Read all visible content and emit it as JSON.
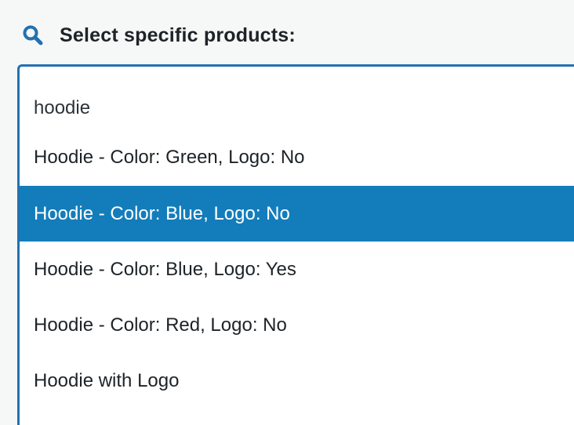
{
  "header": {
    "icon": "search-icon",
    "title": "Select specific products:"
  },
  "search": {
    "value": "hoodie"
  },
  "results": [
    {
      "label": "Hoodie - Color: Green, Logo: No",
      "highlighted": false
    },
    {
      "label": "Hoodie - Color: Blue, Logo: No",
      "highlighted": true
    },
    {
      "label": "Hoodie - Color: Blue, Logo: Yes",
      "highlighted": false
    },
    {
      "label": "Hoodie - Color: Red, Logo: No",
      "highlighted": false
    },
    {
      "label": "Hoodie with Logo",
      "highlighted": false
    }
  ],
  "colors": {
    "accent": "#2271b1",
    "highlight": "#137dbb",
    "background": "#f6f7f7"
  }
}
